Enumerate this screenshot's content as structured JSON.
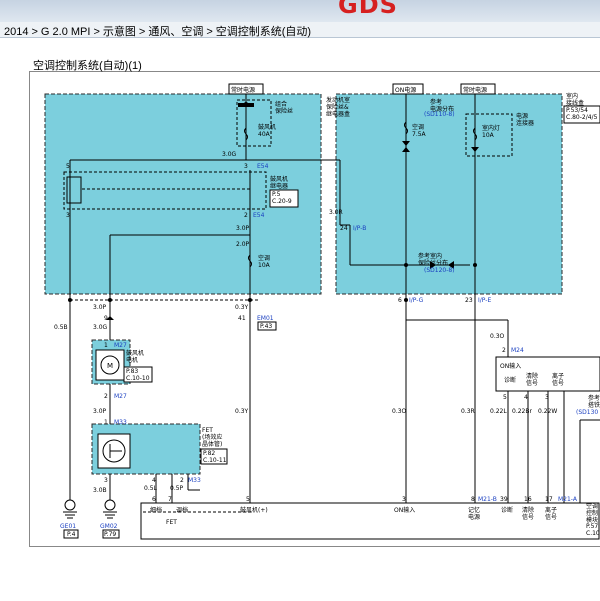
{
  "header": {
    "logo": "GDS"
  },
  "breadcrumb": [
    "2014",
    "G 2.0 MPI",
    "示意图",
    "通风、空调",
    "空调控制系统(自动)"
  ],
  "breadcrumb_sep": ">",
  "panel": {
    "title": "空调控制系统(自动)(1)"
  },
  "diagram": {
    "hot_top": "常时电源",
    "on_power": "ON电源",
    "hot_right": "常时电源",
    "comb_fuse": "组合\n保险丝",
    "engine_box": "发动机室\n保险丝&\n继电器盒",
    "blower_fuse": "鼓风机\n40A",
    "w_3p0w_a": "3.0G",
    "c_e54_top": "E54",
    "blower_relay": "鼓风机\n继电器",
    "blower_relay_ref": "P.5\nC.20-9",
    "c_e54_bot": "E54",
    "pin5": "5",
    "pin3": "3",
    "pin2": "2",
    "w_3p0p_a": "3.0P",
    "w_2p0p": "2.0P",
    "ac_fuse_l": "空调\n10A",
    "w_3p0r": "3.0R",
    "c_ip_b": "I/P-B",
    "pin24": "24",
    "ref_power": "参考\n电源分布",
    "ref_power_code": "(SD110-8)",
    "ac_fuse_r": "空调\n7.5A",
    "room_lamp": "室内灯\n10A",
    "power_conn": "电源\n连接器",
    "room_jb": "室内\n接线盒",
    "room_jb_ref": "P.53/54\nC.80-2/4/5",
    "ref_room": "参考室内\n保险丝分布",
    "ref_room_code": "(SD120-8)",
    "c_ip_g": "I/P-G",
    "c_ip_e": "I/P-E",
    "pin6": "6",
    "pin23": "23",
    "w_3p0p_b": "3.0P",
    "w_0p3y_a": "0.3Y",
    "c_em01": "EM01",
    "em01_ref": "P.43",
    "pin9": "9",
    "pin41": "41",
    "w_0p5b": "0.5B",
    "w_3p0g_b": "3.0G",
    "c_m27_a": "M27",
    "blower_motor": "鼓风机\n电机",
    "blower_motor_ref": "P.83\nC.10-10",
    "c_m27_b": "M27",
    "pin1a": "1",
    "pin2a": "2",
    "w_3p0p_c": "3.0P",
    "c_m33_a": "M33",
    "fet": "FET\n(场效应\n晶体管)",
    "fet_ref": "P.82\nC.10-11",
    "w_0p3y_b": "0.3Y",
    "pin1b": "1",
    "pin3a": "3",
    "pin4": "4",
    "pin2b": "2",
    "c_m33_b": "M33",
    "w_3p0b": "3.0B",
    "w_0p5l": "0.5L",
    "w_0p5p": "0.5P",
    "w_0p3o_a": "0.3O",
    "c_m24": "M24",
    "on_input": "ON输入",
    "diag": "诊断",
    "clear_sig": "清除\n信号",
    "remove_sig": "离子\n信号",
    "pin5b": "5",
    "pin4b": "4",
    "pin3b": "3",
    "w_0p3o_b": "0.3O",
    "w_0p3r": "0.3R",
    "w_0p22l": "0.22L",
    "w_0p22br": "0.22Br",
    "w_0p22w": "0.22W",
    "ref_ion": "参考\n搭铁分布",
    "ref_ion_code": "(SD130",
    "gnd_ge01": "GE01",
    "gnd_ge01_ref": "P.4",
    "gnd_gm02": "GM02",
    "gnd_gm02_ref": "P.79",
    "ctrl_fine": "细档",
    "ctrl_coarse": "调档",
    "ctrl_fet": "FET",
    "ctrl_blower": "鼓风机(+)",
    "ctrl_on": "ON输入",
    "ctrl_mem": "记忆\n电源",
    "ctrl_diag": "诊断",
    "ctrl_clear": "清除\n信号",
    "ctrl_ion": "离子\n信号",
    "ctrl_name": "空调\n控制\n模块",
    "ctrl_ref": "P.57\nC.10",
    "cp6": "6",
    "cp7": "7",
    "cp5": "5",
    "cp3": "3",
    "cp8": "8",
    "c_m21_b": "M21-B",
    "cp39": "39",
    "cp16": "16",
    "cp17": "17",
    "c_m21_a": "M21-A"
  },
  "colors": {
    "zone_fill": "#7ccfdd",
    "logo_red": "#d62020",
    "connector_blue": "#1a3fc0"
  }
}
